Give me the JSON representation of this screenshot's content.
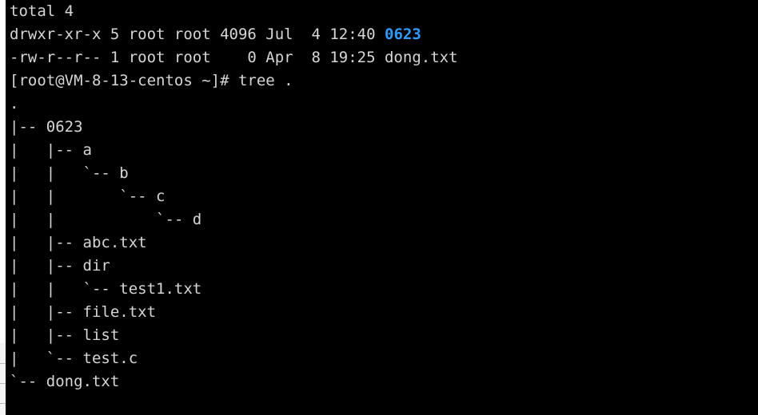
{
  "terminal": {
    "colors": {
      "background": "#000000",
      "foreground": "#d6d6d6",
      "directory": "#2f9bff",
      "edge_panel": "#ffffff",
      "edge_panel_lower": "#f4f4f4",
      "edge_panel_divider": "#b9b9b9"
    },
    "prompt": {
      "user": "root",
      "host": "VM-8-13-centos",
      "cwd": "~",
      "symbol": "#",
      "full": "[root@VM-8-13-centos ~]#"
    },
    "commands": [
      "tree ."
    ],
    "ls_output": {
      "total_label": "total 4",
      "entries": [
        {
          "permissions": "drwxr-xr-x",
          "links": "5",
          "owner": "root",
          "group": "root",
          "size": "4096",
          "month": "Jul",
          "day": "4",
          "time": "12:40",
          "name": "0623",
          "type": "directory"
        },
        {
          "permissions": "-rw-r--r--",
          "links": "1",
          "owner": "root",
          "group": "root",
          "size": "0",
          "month": "Apr",
          "day": "8",
          "time": "19:25",
          "name": "dong.txt",
          "type": "file"
        }
      ]
    },
    "tree_output": {
      "root": ".",
      "entries": [
        "|-- 0623",
        "|   |-- a",
        "|   |   `-- b",
        "|   |       `-- c",
        "|   |           `-- d",
        "|   |-- abc.txt",
        "|   |-- dir",
        "|   |   `-- test1.txt",
        "|   |-- file.txt",
        "|   |-- list",
        "|   `-- test.c",
        "`-- dong.txt"
      ]
    },
    "lines": [
      {
        "id": "line-total",
        "segments": [
          {
            "text": "total 4",
            "color": "default"
          }
        ]
      },
      {
        "id": "line-ls-dir-0623",
        "segments": [
          {
            "text": "drwxr-xr-x 5 root root 4096 Jul  4 12:40 ",
            "color": "default"
          },
          {
            "text": "0623",
            "color": "dir"
          }
        ]
      },
      {
        "id": "line-ls-file-dong",
        "segments": [
          {
            "text": "-rw-r--r-- 1 root root    0 Apr  8 19:25 dong.txt",
            "color": "default"
          }
        ]
      },
      {
        "id": "line-prompt-tree",
        "segments": [
          {
            "text": "[root@VM-8-13-centos ~]# tree .",
            "color": "default"
          }
        ]
      },
      {
        "id": "line-tree-root",
        "segments": [
          {
            "text": ".",
            "color": "default"
          }
        ]
      },
      {
        "id": "line-tree-0623",
        "segments": [
          {
            "text": "|-- 0623",
            "color": "default"
          }
        ]
      },
      {
        "id": "line-tree-a",
        "segments": [
          {
            "text": "|   |-- a",
            "color": "default"
          }
        ]
      },
      {
        "id": "line-tree-b",
        "segments": [
          {
            "text": "|   |   `-- b",
            "color": "default"
          }
        ]
      },
      {
        "id": "line-tree-c",
        "segments": [
          {
            "text": "|   |       `-- c",
            "color": "default"
          }
        ]
      },
      {
        "id": "line-tree-d",
        "segments": [
          {
            "text": "|   |           `-- d",
            "color": "default"
          }
        ]
      },
      {
        "id": "line-tree-abc",
        "segments": [
          {
            "text": "|   |-- abc.txt",
            "color": "default"
          }
        ]
      },
      {
        "id": "line-tree-dir",
        "segments": [
          {
            "text": "|   |-- dir",
            "color": "default"
          }
        ]
      },
      {
        "id": "line-tree-test1",
        "segments": [
          {
            "text": "|   |   `-- test1.txt",
            "color": "default"
          }
        ]
      },
      {
        "id": "line-tree-file",
        "segments": [
          {
            "text": "|   |-- file.txt",
            "color": "default"
          }
        ]
      },
      {
        "id": "line-tree-list",
        "segments": [
          {
            "text": "|   |-- list",
            "color": "default"
          }
        ]
      },
      {
        "id": "line-tree-testc",
        "segments": [
          {
            "text": "|   `-- test.c",
            "color": "default"
          }
        ]
      },
      {
        "id": "line-tree-dongtxt",
        "segments": [
          {
            "text": "`-- dong.txt",
            "color": "default"
          }
        ]
      }
    ]
  },
  "edge_panel": {
    "divider_offsets": [
      455,
      480,
      505
    ]
  }
}
